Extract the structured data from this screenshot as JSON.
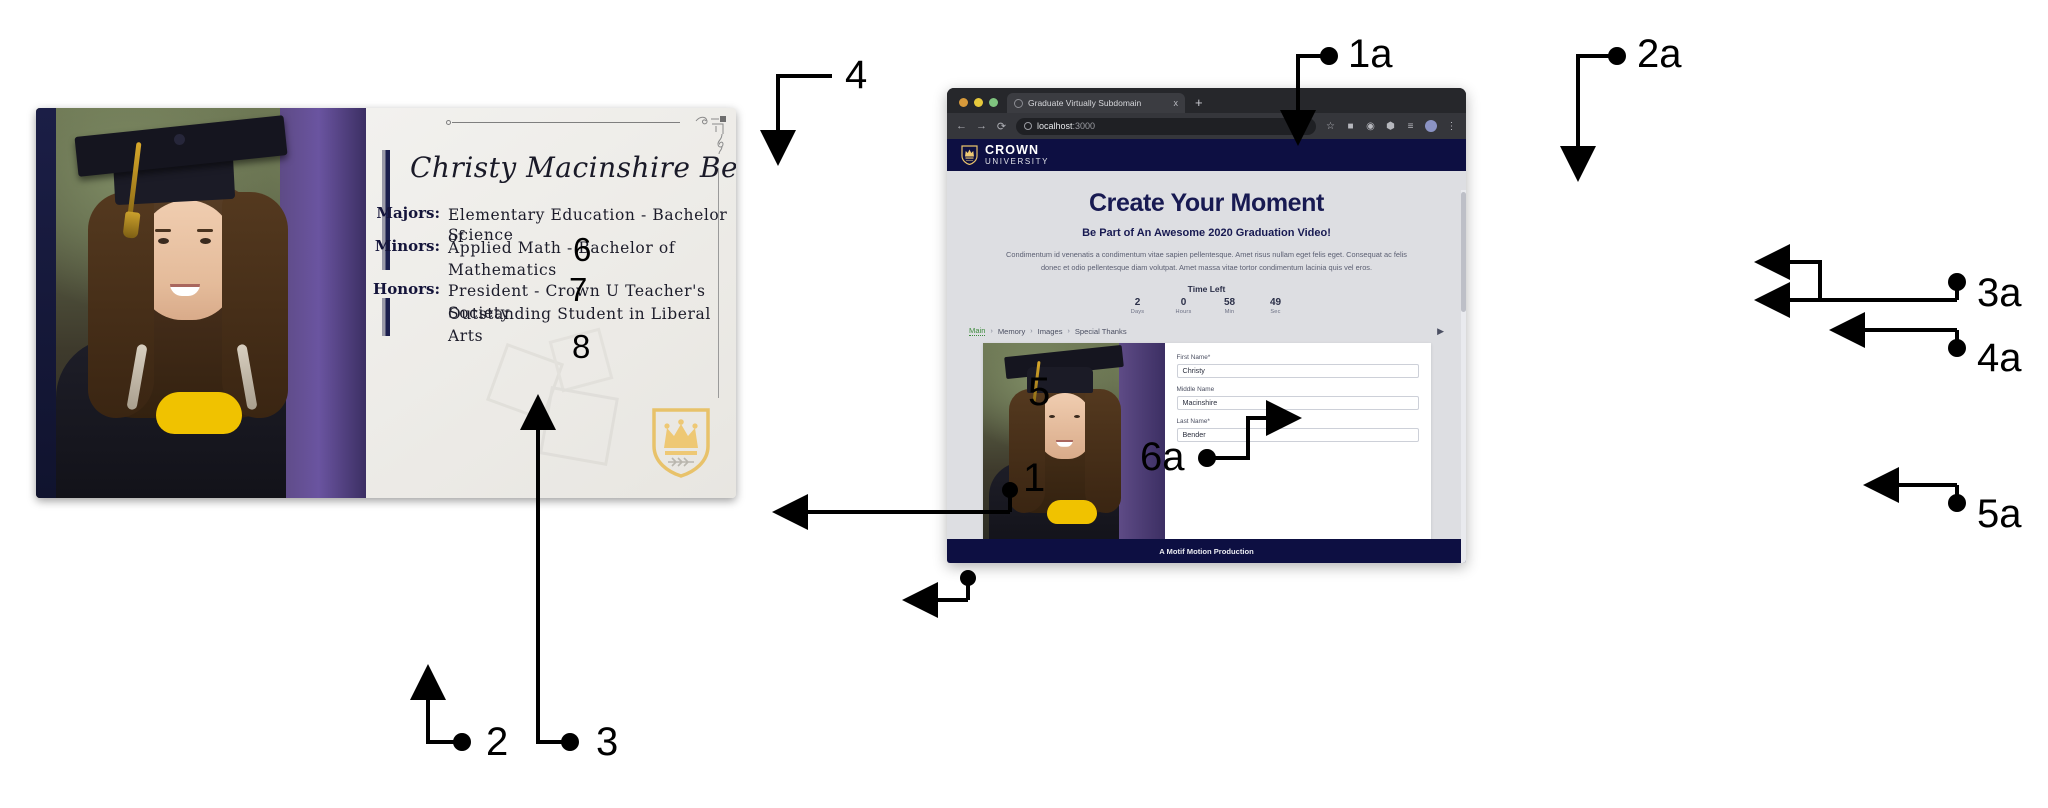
{
  "annotations": {
    "left": [
      {
        "id": "1",
        "label": "1"
      },
      {
        "id": "2",
        "label": "2"
      },
      {
        "id": "3",
        "label": "3"
      },
      {
        "id": "4",
        "label": "4"
      },
      {
        "id": "5",
        "label": "5"
      },
      {
        "id": "6",
        "label": "6"
      },
      {
        "id": "7",
        "label": "7"
      },
      {
        "id": "8",
        "label": "8"
      }
    ],
    "right": [
      {
        "id": "1a",
        "label": "1a"
      },
      {
        "id": "2a",
        "label": "2a"
      },
      {
        "id": "3a",
        "label": "3a"
      },
      {
        "id": "4a",
        "label": "4a"
      },
      {
        "id": "5a",
        "label": "5a"
      },
      {
        "id": "6a",
        "label": "6a"
      }
    ]
  },
  "card": {
    "student_name": "Christy Macinshire Bender",
    "fields": [
      {
        "label": "Majors:",
        "value": "Elementary Education - Bachelor of Science"
      },
      {
        "label": "Minors:",
        "value": "Applied Math - Bachelor of Mathematics"
      }
    ],
    "majors_label": "Majors:",
    "majors_line1": "Elementary Education - Bachelor of",
    "majors_line2": "Science",
    "minors_label": "Minors:",
    "minors_value": "Applied Math - Bachelor of Mathematics",
    "honors_label": "Honors:",
    "honors_line1": "President - Crown U Teacher's Society",
    "honors_line2": "Outstanding Student in Liberal Arts",
    "badge_icon": "crown-shield-icon"
  },
  "browser": {
    "traffic_lights": [
      "close",
      "minimize",
      "maximize"
    ],
    "tab": {
      "title": "Graduate Virtually Subdomain",
      "favicon": "page-favicon",
      "close_icon": "x",
      "new_tab_icon": "+"
    },
    "toolbar": {
      "back_icon": "←",
      "forward_icon": "→",
      "reload_icon": "⟳",
      "lock_icon": "info-circle-icon",
      "url_host": "localhost",
      "url_port": ":3000",
      "star_icon": "☆",
      "camera_icon": "■",
      "extension_icon": "◉",
      "puzzle_icon": "⬢",
      "list_icon": "≡",
      "avatar_icon": "profile-avatar",
      "menu_icon": "⋮"
    }
  },
  "site": {
    "logo": {
      "line1": "CROWN",
      "line2": "UNIVERSITY",
      "icon": "crown-shield-icon"
    },
    "hero": {
      "title": "Create Your Moment",
      "subtitle": "Be Part of An Awesome 2020 Graduation Video!",
      "body": "Condimentum id venenatis a condimentum vitae sapien pellentesque. Amet risus nullam eget felis eget. Consequat ac felis donec et odio pellentesque diam volutpat. Amet massa vitae tortor condimentum lacinia quis vel eros."
    },
    "timer": {
      "title": "Time Left",
      "cells": [
        {
          "value": "2",
          "unit": "Days"
        },
        {
          "value": "0",
          "unit": "Hours"
        },
        {
          "value": "58",
          "unit": "Min"
        },
        {
          "value": "49",
          "unit": "Sec"
        }
      ]
    },
    "breadcrumbs": [
      {
        "label": "Main",
        "active": true
      },
      {
        "label": "Memory",
        "active": false
      },
      {
        "label": "Images",
        "active": false
      },
      {
        "label": "Special Thanks",
        "active": false
      }
    ],
    "breadcrumb_sep": "›",
    "breadcrumb_next": "▶",
    "form": {
      "fields": [
        {
          "label": "First Name*",
          "value": "Christy"
        },
        {
          "label": "Middle Name",
          "value": "Macinshire"
        },
        {
          "label": "Last Name*",
          "value": "Bender"
        }
      ]
    },
    "footer": "A Motif Motion Production"
  },
  "colors": {
    "navy": "#0d0f42",
    "gold": "#e8c26a",
    "hero_navy": "#181a52",
    "crumb_active": "#3e8b3e"
  }
}
